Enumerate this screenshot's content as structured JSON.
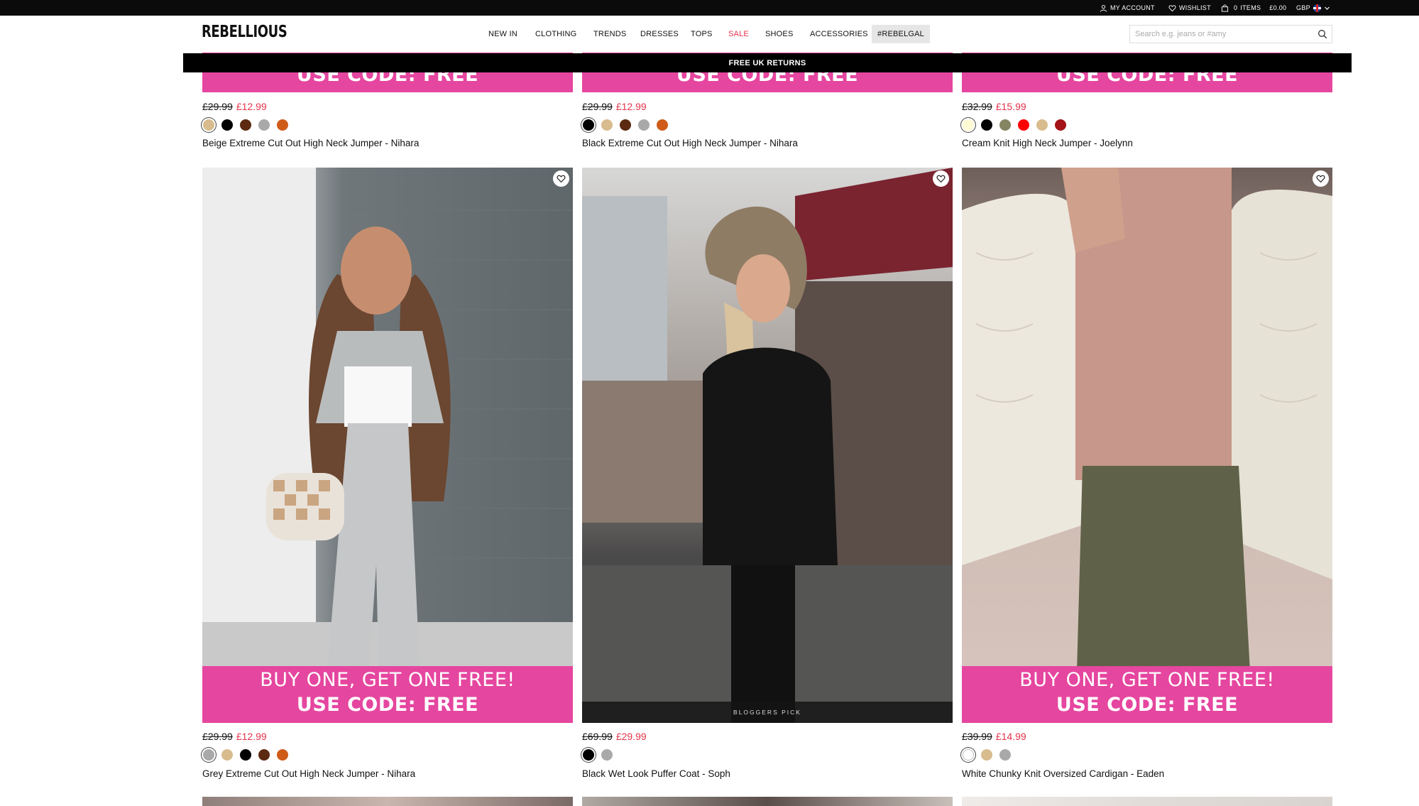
{
  "topbar": {
    "account": "MY ACCOUNT",
    "wishlist": "WISHLIST",
    "bag_count": "0",
    "bag_items": "ITEMS",
    "bag_total": "£0.00",
    "currency": "GBP"
  },
  "header": {
    "logo": "REBELLIOUS",
    "nav": [
      "NEW IN",
      "CLOTHING",
      "TRENDS",
      "DRESSES",
      "TOPS",
      "SALE",
      "SHOES",
      "ACCESSORIES",
      "#REBELGAL"
    ],
    "search_placeholder": "Search e.g. jeans or #amy"
  },
  "banner": "FREE UK RETURNS",
  "promo": {
    "line1": "BUY ONE, GET ONE FREE!",
    "line2": "USE CODE: FREE"
  },
  "badge_bloggers": "BLOGGERS PICK",
  "products_top": [
    {
      "was": "£29.99",
      "now": "£12.99",
      "name": "Beige Extreme Cut Out High Neck Jumper - Nihara",
      "swatches": [
        "#d8bc8e",
        "#000000",
        "#5b2a10",
        "#a9a9a9",
        "#cf5b19"
      ]
    },
    {
      "was": "£29.99",
      "now": "£12.99",
      "name": "Black Extreme Cut Out High Neck Jumper - Nihara",
      "swatches": [
        "#000000",
        "#d8bc8e",
        "#5b2a10",
        "#a9a9a9",
        "#cf5b19"
      ]
    },
    {
      "was": "£32.99",
      "now": "£15.99",
      "name": "Cream Knit High Neck Jumper - Joelynn",
      "swatches": [
        "#fffbd5",
        "#000000",
        "#858463",
        "#ff0000",
        "#d8bc8e",
        "#a41318"
      ]
    }
  ],
  "products_main": [
    {
      "was": "£29.99",
      "now": "£12.99",
      "name": "Grey Extreme Cut Out High Neck Jumper - Nihara",
      "swatches": [
        "#a9a9a9",
        "#d8bc8e",
        "#000000",
        "#5b2a10",
        "#cf5b19"
      ]
    },
    {
      "was": "£69.99",
      "now": "£29.99",
      "name": "Black Wet Look Puffer Coat - Soph",
      "swatches": [
        "#000000",
        "#a9a9a9"
      ]
    },
    {
      "was": "£39.99",
      "now": "£14.99",
      "name": "White Chunky Knit Oversized Cardigan - Eaden",
      "swatches": [
        "#ffffff",
        "#d8bc8e",
        "#a9a9a9"
      ]
    }
  ]
}
